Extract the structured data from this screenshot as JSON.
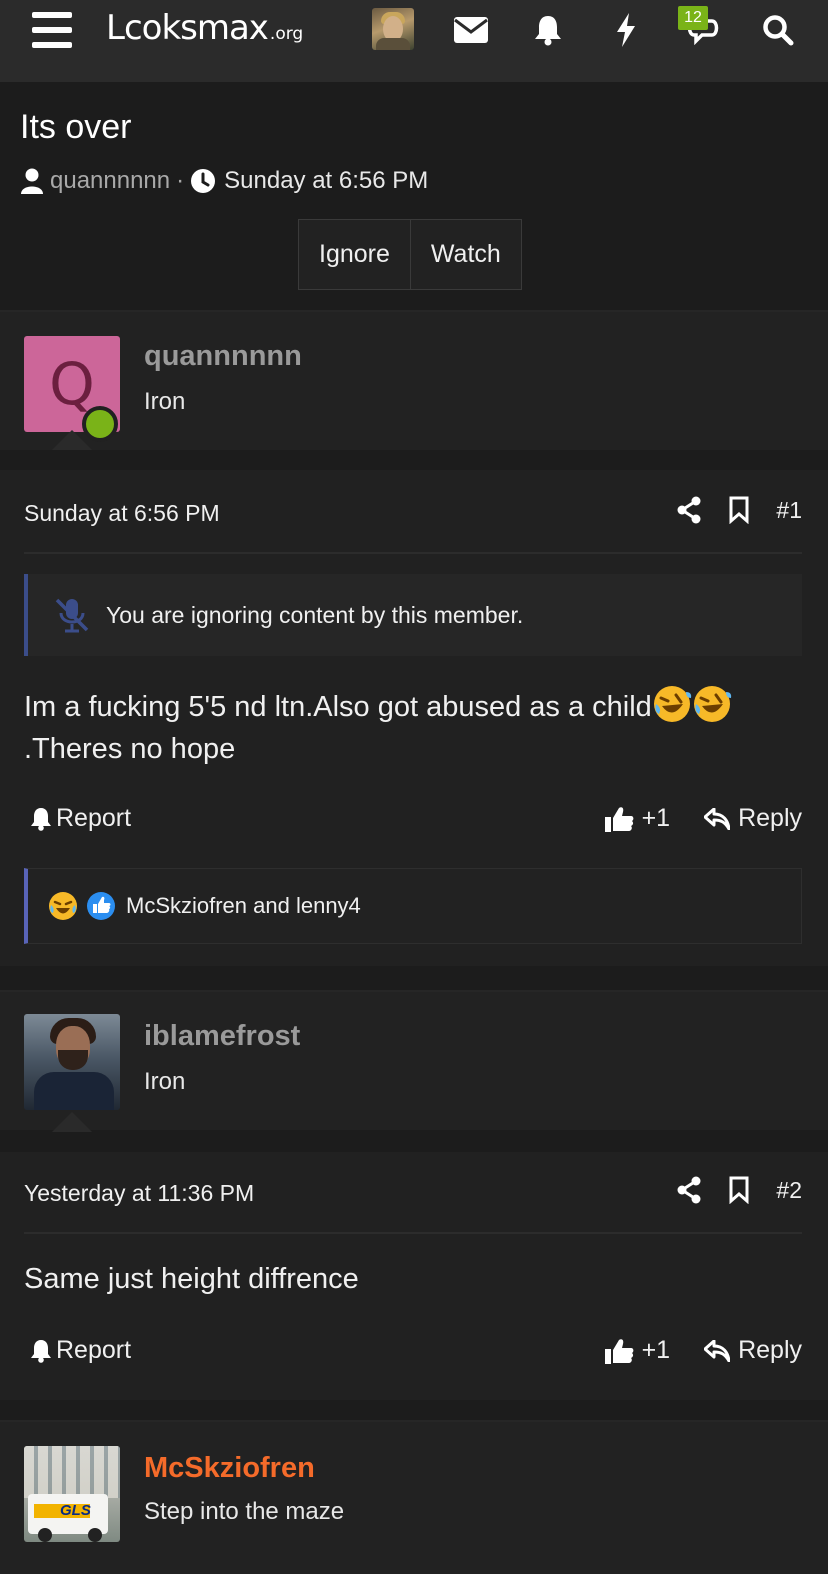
{
  "site": {
    "logo_main": "Lcoksmax",
    "logo_tld": ".org",
    "notification_badge": "12"
  },
  "thread": {
    "title": "Its over",
    "author": "quannnnnn",
    "separator": "·",
    "date": "Sunday at 6:56 PM",
    "buttons": {
      "ignore": "Ignore",
      "watch": "Watch"
    }
  },
  "posts": [
    {
      "username": "quannnnnn",
      "user_title": "Iron",
      "avatar_letter": "Q",
      "date": "Sunday at 6:56 PM",
      "number": "#1",
      "ignore_notice": "You are ignoring content by this member.",
      "message_line1": "Im a fucking 5'5 nd ltn.Also got abused as a child",
      "message_line2": ".Theres no hope",
      "report": "Report",
      "likes": "+1",
      "reply": "Reply",
      "reactions_text": "McSkziofren and lenny4"
    },
    {
      "username": "iblamefrost",
      "user_title": "Iron",
      "date": "Yesterday at 11:36 PM",
      "number": "#2",
      "message": "Same just height diffrence",
      "report": "Report",
      "likes": "+1",
      "reply": "Reply"
    },
    {
      "username": "McSkziofren",
      "user_title": "Step into the maze",
      "username_color": "#f56b2a",
      "avatar_text": "GLS"
    }
  ],
  "colors": {
    "accent_green": "#7ab318",
    "username_orange": "#f56b2a",
    "ignore_border": "#3b4d8a",
    "reactions_border": "#5964b8"
  }
}
